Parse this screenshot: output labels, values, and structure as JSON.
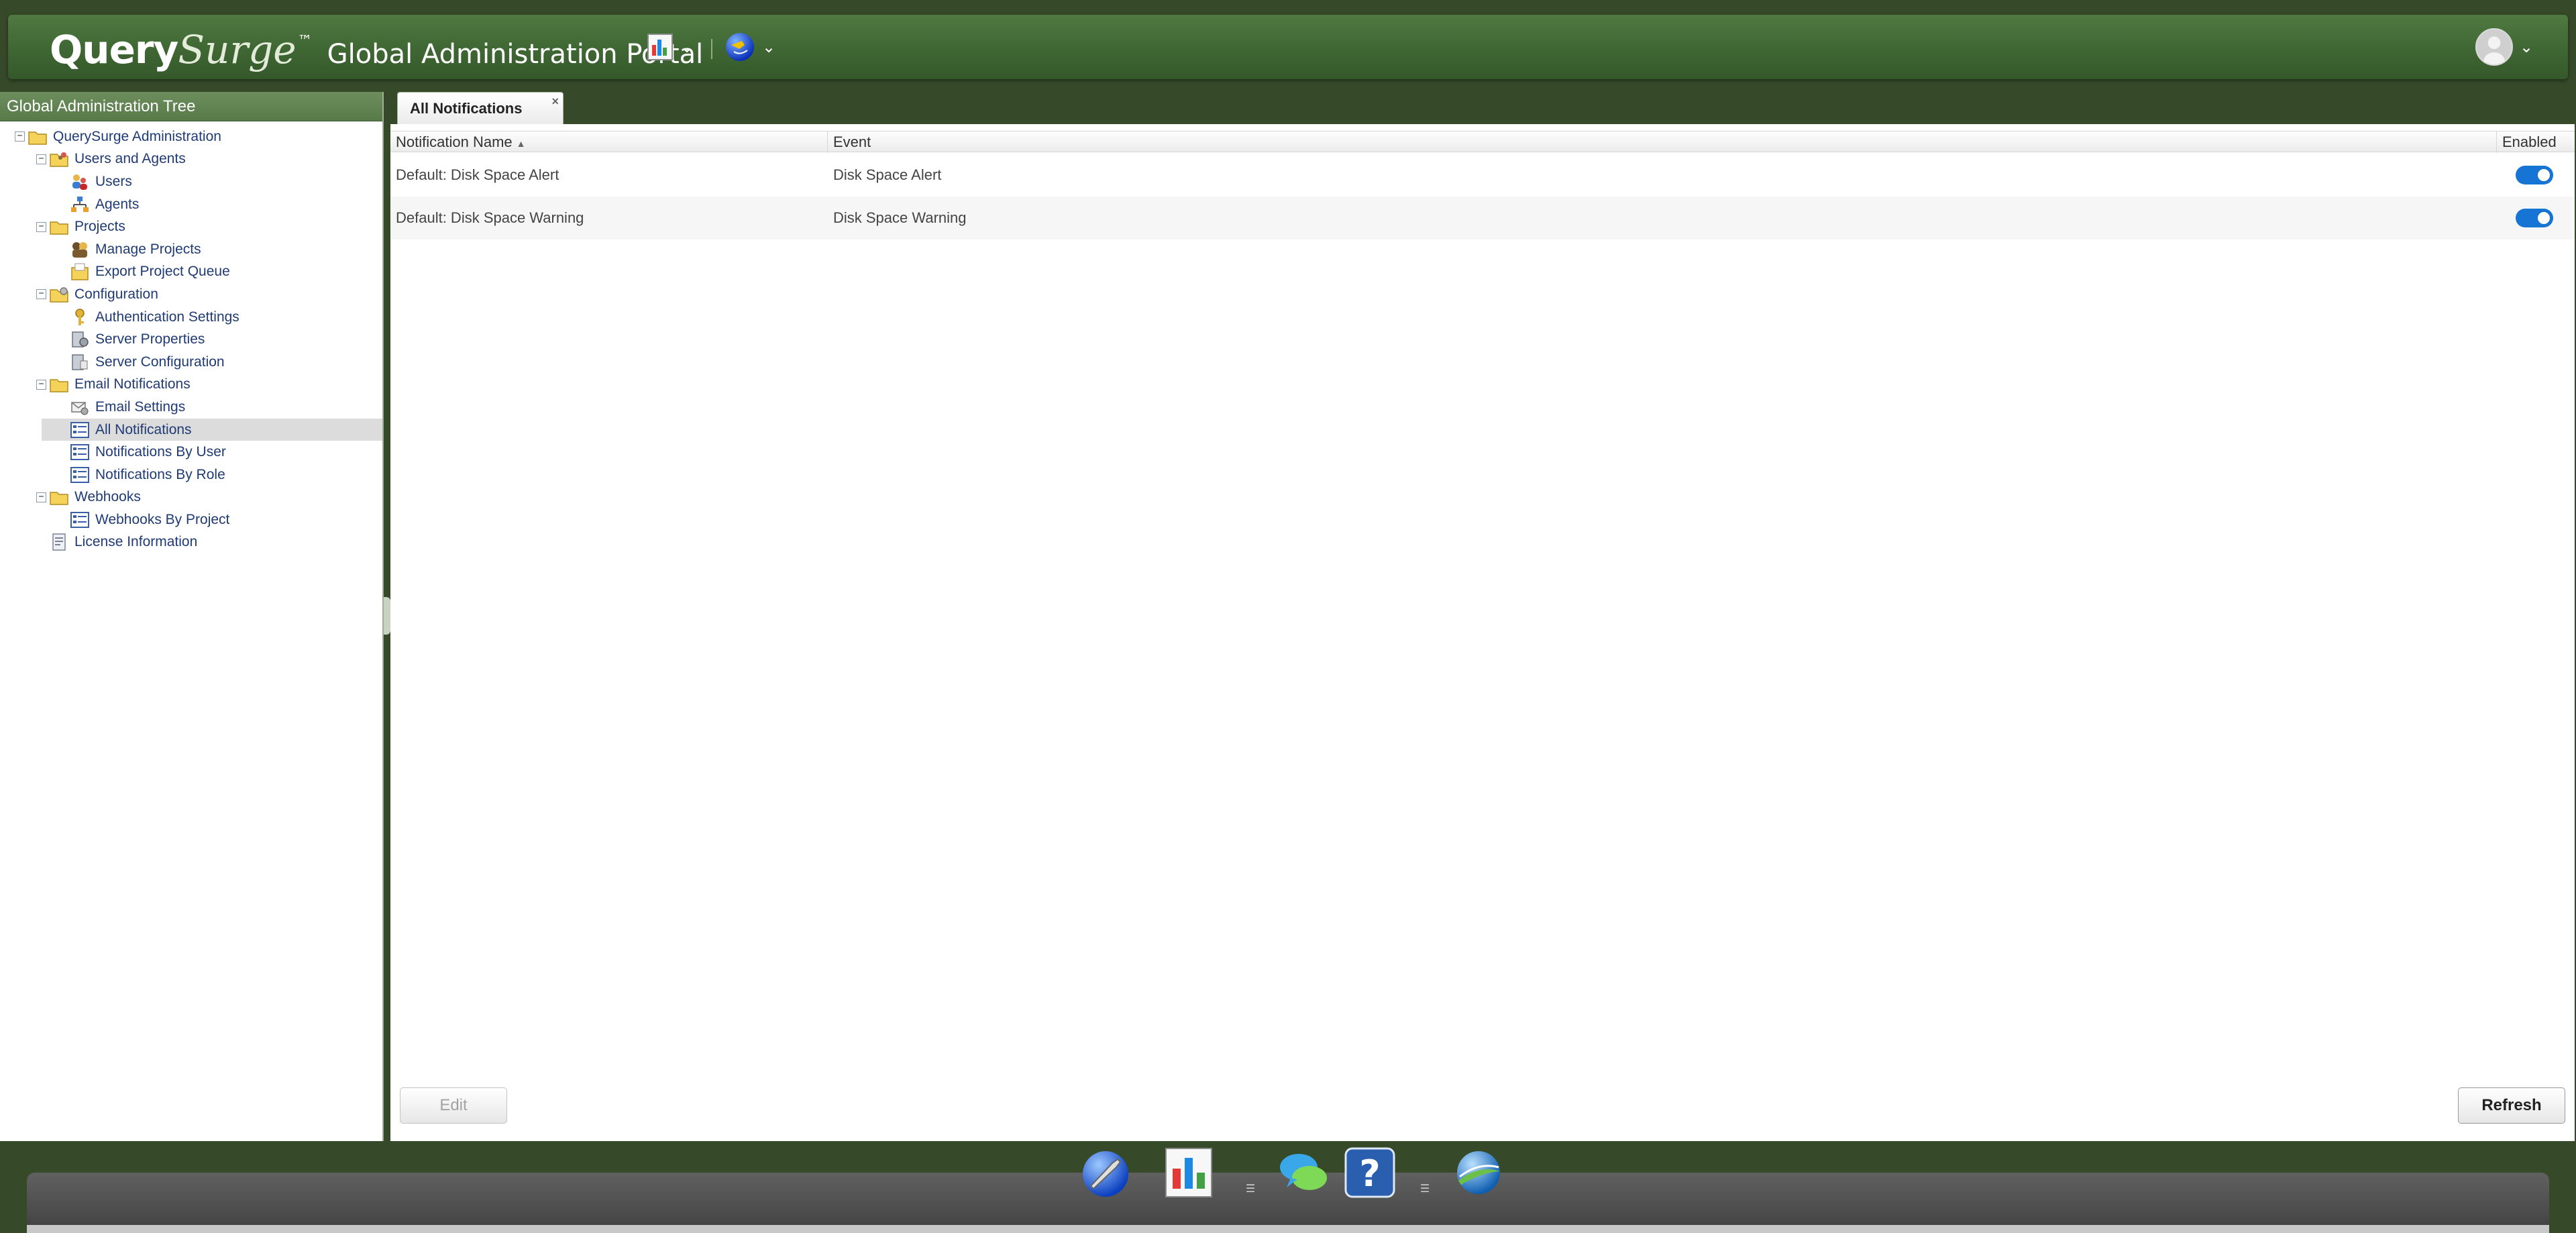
{
  "header": {
    "logo_query": "Query",
    "logo_surge": "Surge",
    "logo_tm": "™",
    "portal_title": "Global Administration Portal",
    "icons": [
      "dashboard-menu-icon",
      "globe-menu-icon",
      "user-avatar-icon"
    ]
  },
  "tree": {
    "title": "Global Administration Tree",
    "nodes": [
      {
        "label": "QuerySurge Administration",
        "level": 0,
        "expander": "−",
        "icon": "folder"
      },
      {
        "label": "Users and Agents",
        "level": 1,
        "expander": "−",
        "icon": "folder-users"
      },
      {
        "label": "Users",
        "level": 2,
        "icon": "users"
      },
      {
        "label": "Agents",
        "level": 2,
        "icon": "agents"
      },
      {
        "label": "Projects",
        "level": 1,
        "expander": "−",
        "icon": "folder"
      },
      {
        "label": "Manage Projects",
        "level": 2,
        "icon": "manage-projects"
      },
      {
        "label": "Export Project Queue",
        "level": 2,
        "icon": "export-queue"
      },
      {
        "label": "Configuration",
        "level": 1,
        "expander": "−",
        "icon": "folder-config"
      },
      {
        "label": "Authentication Settings",
        "level": 2,
        "icon": "auth"
      },
      {
        "label": "Server Properties",
        "level": 2,
        "icon": "server-properties"
      },
      {
        "label": "Server Configuration",
        "level": 2,
        "icon": "server-config"
      },
      {
        "label": "Email Notifications",
        "level": 1,
        "expander": "−",
        "icon": "folder"
      },
      {
        "label": "Email Settings",
        "level": 2,
        "icon": "email-settings"
      },
      {
        "label": "All Notifications",
        "level": 2,
        "icon": "list",
        "selected": true
      },
      {
        "label": "Notifications By User",
        "level": 2,
        "icon": "list"
      },
      {
        "label": "Notifications By Role",
        "level": 2,
        "icon": "list"
      },
      {
        "label": "Webhooks",
        "level": 1,
        "expander": "−",
        "icon": "folder"
      },
      {
        "label": "Webhooks By Project",
        "level": 2,
        "icon": "list"
      },
      {
        "label": "License Information",
        "level": 1,
        "icon": "license"
      }
    ]
  },
  "tab": {
    "label": "All Notifications",
    "close": "×"
  },
  "grid": {
    "columns": [
      "Notification Name",
      "Event",
      "Enabled"
    ],
    "sort_indicator": "▲",
    "rows": [
      {
        "name": "Default: Disk Space Alert",
        "event": "Disk Space Alert",
        "enabled": true
      },
      {
        "name": "Default: Disk Space Warning",
        "event": "Disk Space Warning",
        "enabled": true
      }
    ]
  },
  "buttons": {
    "edit": "Edit",
    "refresh": "Refresh"
  },
  "dock": {
    "icons": [
      "admin-globe-wrench-icon",
      "dashboard-chart-icon",
      "chat-bubbles-icon",
      "help-question-icon",
      "querysurge-globe-icon"
    ],
    "separator": "☰"
  },
  "colors": {
    "background": "#364a2a",
    "header": "#406834",
    "toggle": "#1574d4",
    "tree_text": "#1f3a74"
  }
}
